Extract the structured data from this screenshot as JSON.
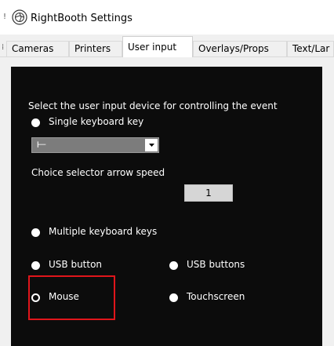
{
  "window": {
    "title": "RightBooth Settings",
    "left_edge_glyph": "!",
    "icon": "app-logo-icon"
  },
  "tabs": [
    {
      "label": "Cameras",
      "active": false
    },
    {
      "label": "Printers",
      "active": false
    },
    {
      "label": "User input",
      "active": true
    },
    {
      "label": "Overlays/Props",
      "active": false
    },
    {
      "label": "Text/Lar",
      "active": false
    }
  ],
  "panel": {
    "prompt": "Select the user input device for controlling the event",
    "options": {
      "single_key": {
        "label": "Single keyboard key",
        "selected": false
      },
      "multiple_keys": {
        "label": "Multiple keyboard keys",
        "selected": false
      },
      "usb_button": {
        "label": "USB button",
        "selected": false
      },
      "usb_buttons": {
        "label": "USB buttons",
        "selected": false
      },
      "mouse": {
        "label": "Mouse",
        "selected": true
      },
      "touchscreen": {
        "label": "Touchscreen",
        "selected": false
      }
    },
    "key_select": {
      "value": "⟝",
      "icon": "chevron-down-icon"
    },
    "arrow_speed": {
      "label": "Choice selector arrow speed",
      "value": "1"
    }
  },
  "colors": {
    "panel_bg": "#0c0c0c",
    "highlight": "#e0151b",
    "dropdown_bg": "#7c7c7c"
  }
}
